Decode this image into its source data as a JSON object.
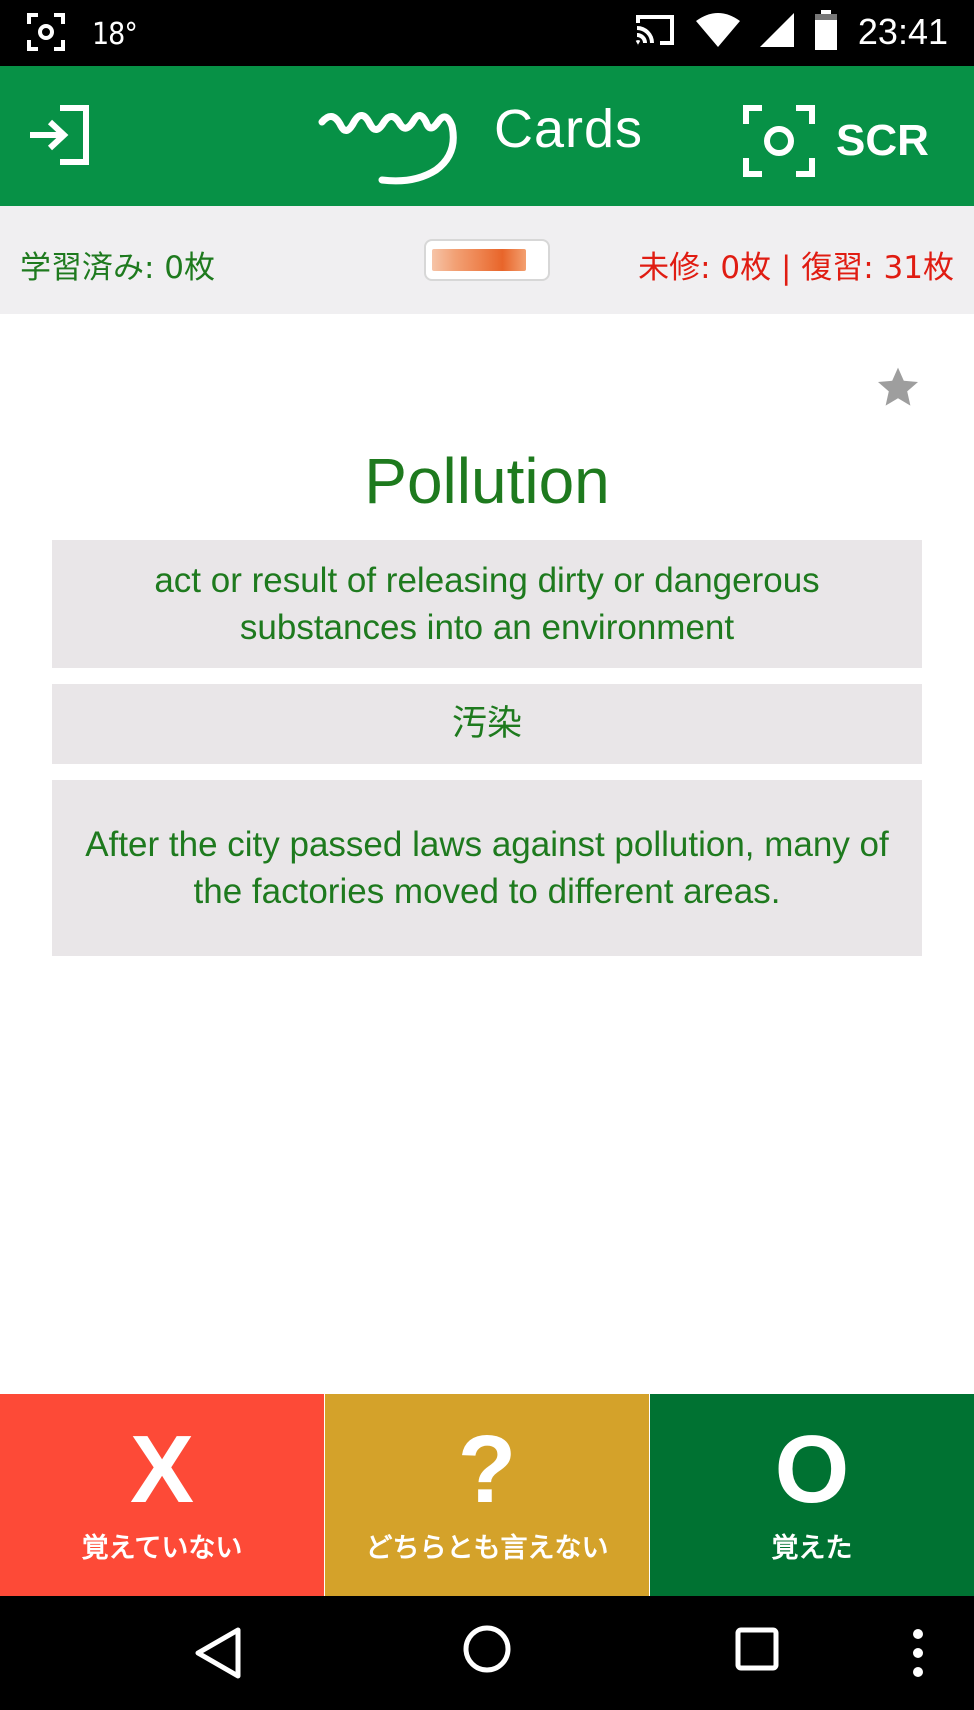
{
  "status_bar": {
    "temperature": "18°",
    "time": "23:41",
    "icons": [
      "screenshot-icon",
      "cast-icon",
      "wifi-icon",
      "signal-icon",
      "battery-icon"
    ]
  },
  "header": {
    "logo_script": "my",
    "logo_text": "Cards",
    "scr_label": "SCR",
    "color": "#079146"
  },
  "progress": {
    "learned": "学習済み: 0枚",
    "stats": "未修: 0枚 | 復習: 31枚",
    "fill_fraction": 0.85
  },
  "card": {
    "word": "Pollution",
    "definition": "act or result of releasing dirty or dangerous substances into an environment",
    "translation": "汚染",
    "example": "After the city passed laws against pollution, many of the factories moved to different areas.",
    "text_color": "#1e7a1e"
  },
  "answers": {
    "no": {
      "symbol": "X",
      "label": "覚えていない",
      "color": "#fd4a37"
    },
    "maybe": {
      "symbol": "?",
      "label": "どちらとも言えない",
      "color": "#d4a22a"
    },
    "yes": {
      "symbol": "O",
      "label": "覚えた",
      "color": "#007232"
    }
  }
}
